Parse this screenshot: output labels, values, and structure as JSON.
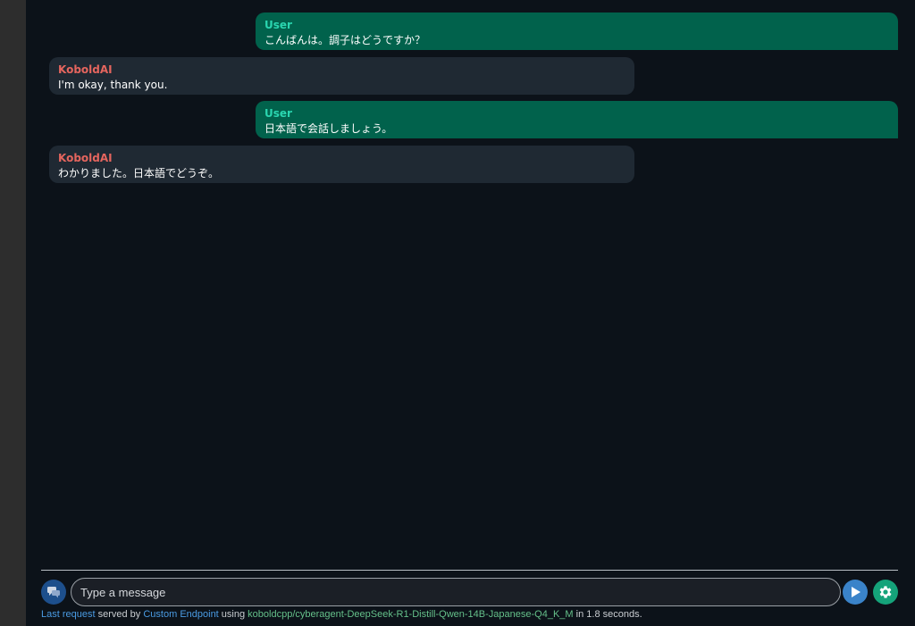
{
  "messages": [
    {
      "role": "user",
      "speaker": "User",
      "text": "こんばんは。調子はどうですか？"
    },
    {
      "role": "ai",
      "speaker": "KoboldAI",
      "text": "I'm okay, thank you."
    },
    {
      "role": "user",
      "speaker": "User",
      "text": "日本語で会話しましょう。"
    },
    {
      "role": "ai",
      "speaker": "KoboldAI",
      "text": "わかりました。日本語でどうぞ。"
    }
  ],
  "input": {
    "placeholder": "Type a message",
    "value": ""
  },
  "status": {
    "last_request": "Last request",
    "served_by": " served by ",
    "endpoint": "Custom Endpoint",
    "using": " using ",
    "model": "koboldcpp/cyberagent-DeepSeek-R1-Distill-Qwen-14B-Japanese-Q4_K_M",
    "in": " in ",
    "duration": "1.8 seconds."
  },
  "icons": {
    "chat_mode": "chat-bubbles-icon",
    "send": "play-send-icon",
    "settings": "gear-icon"
  },
  "colors": {
    "user_bubble": "#01624c",
    "ai_bubble": "#1f2933",
    "user_name": "#2ad6b0",
    "ai_name": "#e5655e",
    "background": "#0c1219"
  }
}
